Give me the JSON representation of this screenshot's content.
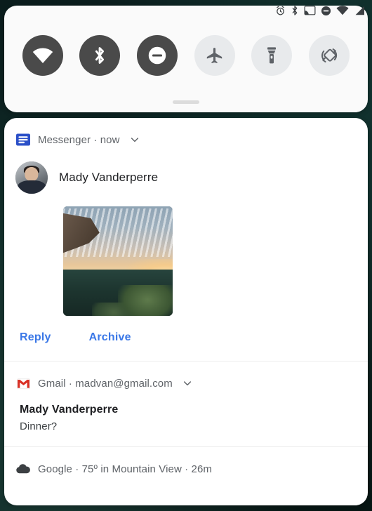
{
  "theme": {
    "accent_blue": "#3b78e7",
    "tile_on_bg": "#4a4a4a",
    "tile_off_bg": "#e8eaec",
    "panel_bg": "#fafafa",
    "card_bg": "#ffffff",
    "wallpaper": "#0d2321",
    "gmail_red": "#d93025",
    "messenger_blue": "#2b50c8"
  },
  "status_bar": {
    "icons": [
      {
        "name": "alarm-icon",
        "label": "Alarm set"
      },
      {
        "name": "bluetooth-icon",
        "label": "Bluetooth on"
      },
      {
        "name": "cast-icon",
        "label": "Cast available"
      },
      {
        "name": "do-not-disturb-icon",
        "label": "Do not disturb on"
      },
      {
        "name": "wifi-icon",
        "label": "Wi-Fi connected"
      },
      {
        "name": "cell-signal-icon",
        "label": "Mobile signal"
      }
    ]
  },
  "quick_settings": {
    "tiles": [
      {
        "name": "wifi-tile",
        "label": "Wi-Fi",
        "state": "on"
      },
      {
        "name": "bluetooth-tile",
        "label": "Bluetooth",
        "state": "on"
      },
      {
        "name": "do-not-disturb-tile",
        "label": "Do Not Disturb",
        "state": "on"
      },
      {
        "name": "airplane-mode-tile",
        "label": "Airplane mode",
        "state": "off"
      },
      {
        "name": "flashlight-tile",
        "label": "Flashlight",
        "state": "off"
      },
      {
        "name": "auto-rotate-tile",
        "label": "Auto-rotate",
        "state": "off"
      }
    ],
    "drag_handle_label": "Expand quick settings"
  },
  "notifications": [
    {
      "id": "messenger",
      "app_name": "Messenger",
      "header_text": "Messenger · now",
      "timestamp": "now",
      "sender": "Mady Vanderperre",
      "has_image": true,
      "image_description": "Sunset over a valley seen from a cliff edge",
      "actions": [
        {
          "name": "reply-action",
          "label": "Reply"
        },
        {
          "name": "archive-action",
          "label": "Archive"
        }
      ]
    },
    {
      "id": "gmail",
      "app_name": "Gmail",
      "account": "madvan@gmail.com",
      "header_text": "Gmail · madvan@gmail.com",
      "title": "Mady Vanderperre",
      "subject": "Dinner?"
    },
    {
      "id": "google-weather",
      "app_name": "Google",
      "header_text": "Google · 75º in Mountain View · 26m",
      "temperature": "75º",
      "location": "Mountain View",
      "timestamp": "26m"
    }
  ]
}
